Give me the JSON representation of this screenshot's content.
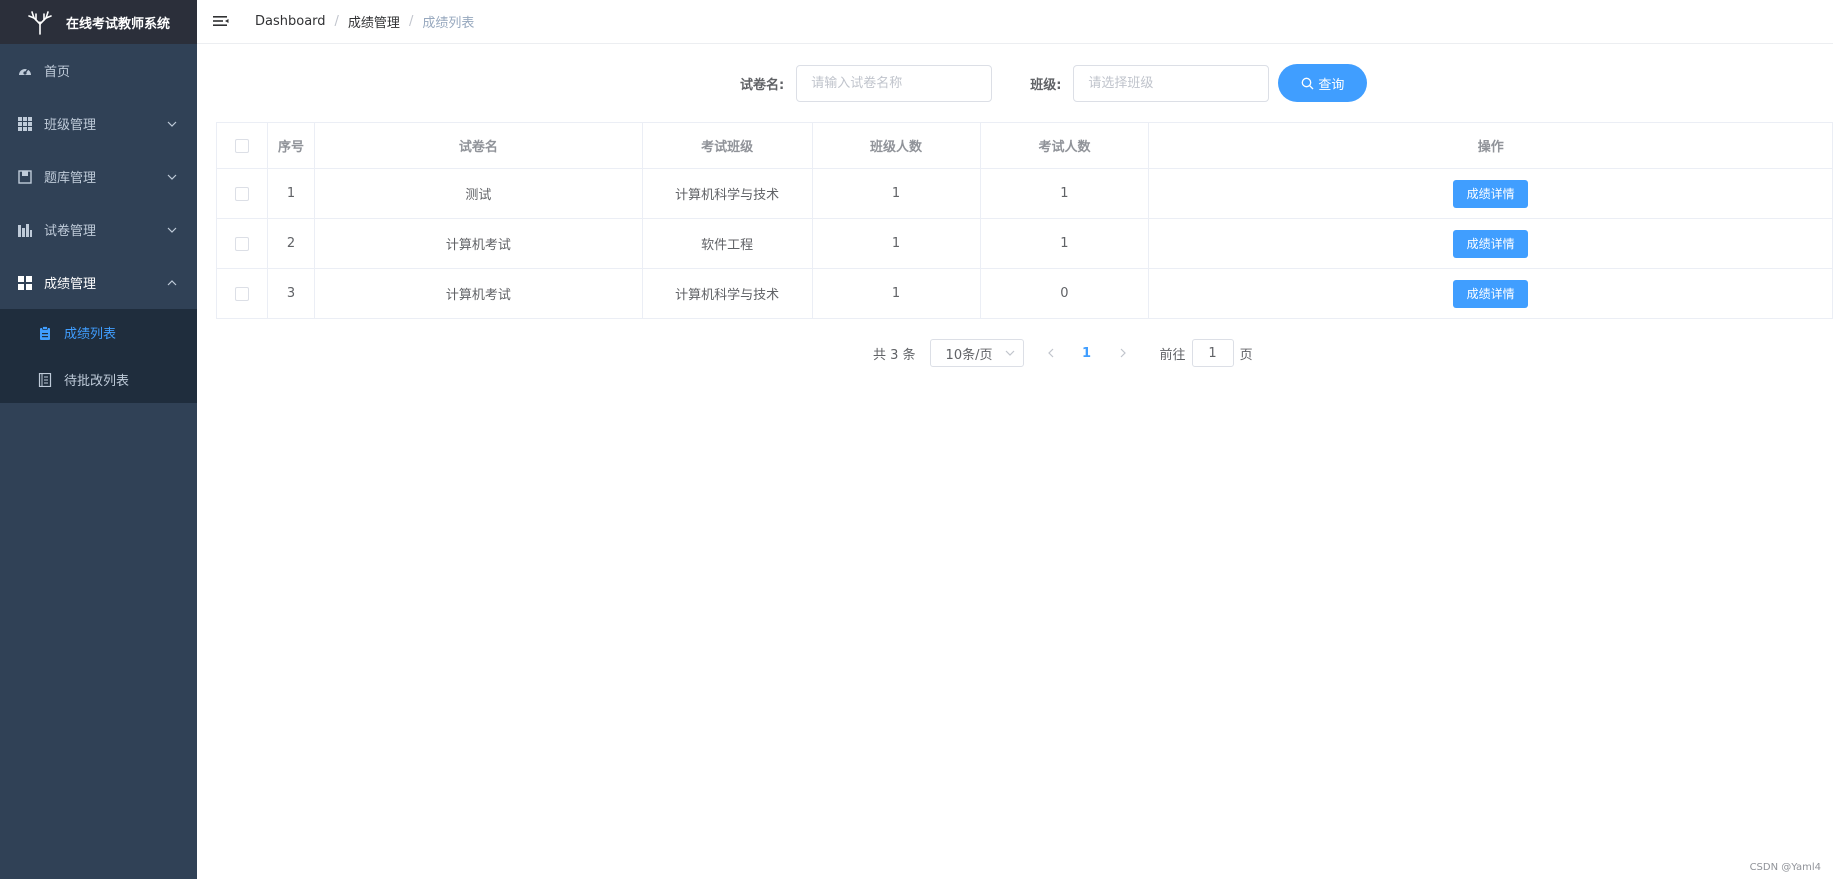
{
  "app": {
    "title": "在线考试教师系统"
  },
  "sidebar": {
    "items": [
      {
        "label": "首页",
        "icon": "dashboard-icon"
      },
      {
        "label": "班级管理",
        "icon": "grid-icon"
      },
      {
        "label": "题库管理",
        "icon": "book-icon"
      },
      {
        "label": "试卷管理",
        "icon": "chart-icon"
      },
      {
        "label": "成绩管理",
        "icon": "apps-icon"
      }
    ],
    "submenu": [
      {
        "label": "成绩列表",
        "icon": "clipboard-icon",
        "active": true
      },
      {
        "label": "待批改列表",
        "icon": "document-icon"
      }
    ]
  },
  "header": {
    "breadcrumb": [
      "Dashboard",
      "成绩管理",
      "成绩列表"
    ]
  },
  "search": {
    "paper_label": "试卷名:",
    "paper_placeholder": "请输入试卷名称",
    "class_label": "班级:",
    "class_placeholder": "请选择班级",
    "query_button": "查询"
  },
  "table": {
    "headers": [
      "序号",
      "试卷名",
      "考试班级",
      "班级人数",
      "考试人数",
      "操作"
    ],
    "rows": [
      {
        "index": "1",
        "paper": "测试",
        "class": "计算机科学与技术",
        "class_count": "1",
        "exam_count": "1",
        "action": "成绩详情"
      },
      {
        "index": "2",
        "paper": "计算机考试",
        "class": "软件工程",
        "class_count": "1",
        "exam_count": "1",
        "action": "成绩详情"
      },
      {
        "index": "3",
        "paper": "计算机考试",
        "class": "计算机科学与技术",
        "class_count": "1",
        "exam_count": "0",
        "action": "成绩详情"
      }
    ]
  },
  "pagination": {
    "total": "共 3 条",
    "page_size": "10条/页",
    "current": "1",
    "goto_label": "前往",
    "goto_value": "1",
    "page_suffix": "页"
  },
  "watermark": "CSDN @Yaml4",
  "colors": {
    "sidebar_bg": "#304156",
    "accent": "#409eff",
    "submenu_bg": "#1f2d3d"
  }
}
